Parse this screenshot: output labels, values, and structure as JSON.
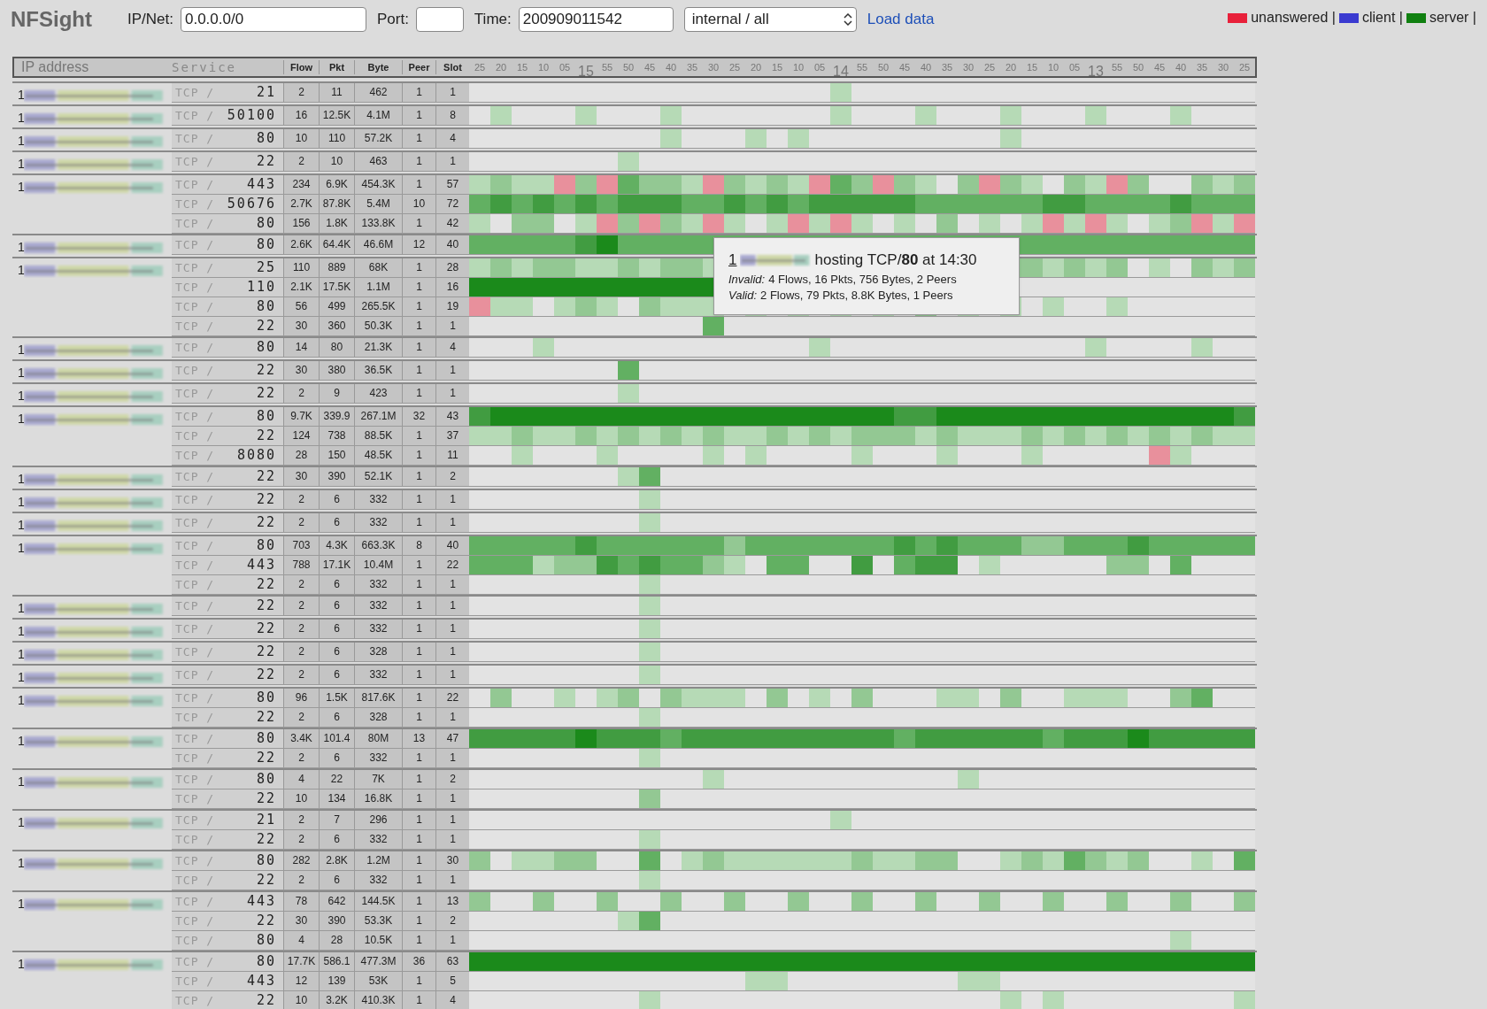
{
  "app": {
    "title": "NFSight"
  },
  "filters": {
    "ipnet_label": "IP/Net:",
    "ipnet_value": "0.0.0.0/0",
    "port_label": "Port:",
    "time_label": "Time:",
    "time_value": "200909011542",
    "scope": "internal / all",
    "load": "Load data"
  },
  "legend": [
    {
      "label": "unanswered |",
      "color": "#e8203a"
    },
    {
      "label": "client |",
      "color": "#3a3ad0"
    },
    {
      "label": "server |",
      "color": "#108010"
    }
  ],
  "table": {
    "columns": [
      "IP address",
      "Service",
      "Flow",
      "Pkt",
      "Byte",
      "Peer",
      "Slot"
    ],
    "timeline": [
      {
        "label": "25",
        "kind": "minute"
      },
      {
        "label": "20",
        "kind": "minute"
      },
      {
        "label": "15",
        "kind": "minute"
      },
      {
        "label": "10",
        "kind": "minute"
      },
      {
        "label": "05",
        "kind": "minute"
      },
      {
        "label": "15",
        "kind": "hour"
      },
      {
        "label": "55",
        "kind": "minute"
      },
      {
        "label": "50",
        "kind": "minute"
      },
      {
        "label": "45",
        "kind": "minute"
      },
      {
        "label": "40",
        "kind": "minute"
      },
      {
        "label": "35",
        "kind": "minute"
      },
      {
        "label": "30",
        "kind": "minute"
      },
      {
        "label": "25",
        "kind": "minute"
      },
      {
        "label": "20",
        "kind": "minute"
      },
      {
        "label": "15",
        "kind": "minute"
      },
      {
        "label": "10",
        "kind": "minute"
      },
      {
        "label": "05",
        "kind": "minute"
      },
      {
        "label": "14",
        "kind": "hour"
      },
      {
        "label": "55",
        "kind": "minute"
      },
      {
        "label": "50",
        "kind": "minute"
      },
      {
        "label": "45",
        "kind": "minute"
      },
      {
        "label": "40",
        "kind": "minute"
      },
      {
        "label": "35",
        "kind": "minute"
      },
      {
        "label": "30",
        "kind": "minute"
      },
      {
        "label": "25",
        "kind": "minute"
      },
      {
        "label": "20",
        "kind": "minute"
      },
      {
        "label": "15",
        "kind": "minute"
      },
      {
        "label": "10",
        "kind": "minute"
      },
      {
        "label": "05",
        "kind": "minute"
      },
      {
        "label": "13",
        "kind": "hour"
      },
      {
        "label": "55",
        "kind": "minute"
      },
      {
        "label": "50",
        "kind": "minute"
      },
      {
        "label": "45",
        "kind": "minute"
      },
      {
        "label": "40",
        "kind": "minute"
      },
      {
        "label": "35",
        "kind": "minute"
      },
      {
        "label": "30",
        "kind": "minute"
      },
      {
        "label": "25",
        "kind": "minute"
      }
    ],
    "hosts": [
      {
        "ip": "1",
        "services": [
          {
            "protocol": "TCP /",
            "port": "21",
            "flow": "2",
            "pkt": "11",
            "byte": "462",
            "peer": "1",
            "slot": "1"
          }
        ]
      },
      {
        "ip": "1",
        "services": [
          {
            "protocol": "TCP /",
            "port": "50100",
            "flow": "16",
            "pkt": "12.5K",
            "byte": "4.1M",
            "peer": "1",
            "slot": "8"
          }
        ]
      },
      {
        "ip": "1",
        "services": [
          {
            "protocol": "TCP /",
            "port": "80",
            "flow": "10",
            "pkt": "110",
            "byte": "57.2K",
            "peer": "1",
            "slot": "4"
          }
        ]
      },
      {
        "ip": "1",
        "services": [
          {
            "protocol": "TCP /",
            "port": "22",
            "flow": "2",
            "pkt": "10",
            "byte": "463",
            "peer": "1",
            "slot": "1"
          }
        ]
      },
      {
        "ip": "1",
        "services": [
          {
            "protocol": "TCP /",
            "port": "443",
            "flow": "234",
            "pkt": "6.9K",
            "byte": "454.3K",
            "peer": "1",
            "slot": "57"
          },
          {
            "protocol": "TCP /",
            "port": "50676",
            "flow": "2.7K",
            "pkt": "87.8K",
            "byte": "5.4M",
            "peer": "10",
            "slot": "72"
          },
          {
            "protocol": "TCP /",
            "port": "80",
            "flow": "156",
            "pkt": "1.8K",
            "byte": "133.8K",
            "peer": "1",
            "slot": "42"
          }
        ]
      },
      {
        "ip": "1",
        "services": [
          {
            "protocol": "TCP /",
            "port": "80",
            "flow": "2.6K",
            "pkt": "64.4K",
            "byte": "46.6M",
            "peer": "12",
            "slot": "40"
          }
        ]
      },
      {
        "ip": "1",
        "services": [
          {
            "protocol": "TCP /",
            "port": "25",
            "flow": "110",
            "pkt": "889",
            "byte": "68K",
            "peer": "1",
            "slot": "28"
          },
          {
            "protocol": "TCP /",
            "port": "110",
            "flow": "2.1K",
            "pkt": "17.5K",
            "byte": "1.1M",
            "peer": "1",
            "slot": "16"
          },
          {
            "protocol": "TCP /",
            "port": "80",
            "flow": "56",
            "pkt": "499",
            "byte": "265.5K",
            "peer": "1",
            "slot": "19"
          },
          {
            "protocol": "TCP /",
            "port": "22",
            "flow": "30",
            "pkt": "360",
            "byte": "50.3K",
            "peer": "1",
            "slot": "1"
          }
        ]
      },
      {
        "ip": "1",
        "services": [
          {
            "protocol": "TCP /",
            "port": "80",
            "flow": "14",
            "pkt": "80",
            "byte": "21.3K",
            "peer": "1",
            "slot": "4"
          }
        ]
      },
      {
        "ip": "1",
        "services": [
          {
            "protocol": "TCP /",
            "port": "22",
            "flow": "30",
            "pkt": "380",
            "byte": "36.5K",
            "peer": "1",
            "slot": "1"
          }
        ]
      },
      {
        "ip": "1",
        "services": [
          {
            "protocol": "TCP /",
            "port": "22",
            "flow": "2",
            "pkt": "9",
            "byte": "423",
            "peer": "1",
            "slot": "1"
          }
        ]
      },
      {
        "ip": "1",
        "services": [
          {
            "protocol": "TCP /",
            "port": "80",
            "flow": "9.7K",
            "pkt": "339.9",
            "byte": "267.1M",
            "peer": "32",
            "slot": "43"
          },
          {
            "protocol": "TCP /",
            "port": "22",
            "flow": "124",
            "pkt": "738",
            "byte": "88.5K",
            "peer": "1",
            "slot": "37"
          },
          {
            "protocol": "TCP /",
            "port": "8080",
            "flow": "28",
            "pkt": "150",
            "byte": "48.5K",
            "peer": "1",
            "slot": "11"
          }
        ]
      },
      {
        "ip": "1",
        "services": [
          {
            "protocol": "TCP /",
            "port": "22",
            "flow": "30",
            "pkt": "390",
            "byte": "52.1K",
            "peer": "1",
            "slot": "2"
          }
        ]
      },
      {
        "ip": "1",
        "services": [
          {
            "protocol": "TCP /",
            "port": "22",
            "flow": "2",
            "pkt": "6",
            "byte": "332",
            "peer": "1",
            "slot": "1"
          }
        ]
      },
      {
        "ip": "1",
        "services": [
          {
            "protocol": "TCP /",
            "port": "22",
            "flow": "2",
            "pkt": "6",
            "byte": "332",
            "peer": "1",
            "slot": "1"
          }
        ]
      },
      {
        "ip": "1",
        "services": [
          {
            "protocol": "TCP /",
            "port": "80",
            "flow": "703",
            "pkt": "4.3K",
            "byte": "663.3K",
            "peer": "8",
            "slot": "40"
          },
          {
            "protocol": "TCP /",
            "port": "443",
            "flow": "788",
            "pkt": "17.1K",
            "byte": "10.4M",
            "peer": "1",
            "slot": "22"
          },
          {
            "protocol": "TCP /",
            "port": "22",
            "flow": "2",
            "pkt": "6",
            "byte": "332",
            "peer": "1",
            "slot": "1"
          }
        ]
      },
      {
        "ip": "1",
        "services": [
          {
            "protocol": "TCP /",
            "port": "22",
            "flow": "2",
            "pkt": "6",
            "byte": "332",
            "peer": "1",
            "slot": "1"
          }
        ]
      },
      {
        "ip": "1",
        "services": [
          {
            "protocol": "TCP /",
            "port": "22",
            "flow": "2",
            "pkt": "6",
            "byte": "332",
            "peer": "1",
            "slot": "1"
          }
        ]
      },
      {
        "ip": "1",
        "services": [
          {
            "protocol": "TCP /",
            "port": "22",
            "flow": "2",
            "pkt": "6",
            "byte": "328",
            "peer": "1",
            "slot": "1"
          }
        ]
      },
      {
        "ip": "1",
        "services": [
          {
            "protocol": "TCP /",
            "port": "22",
            "flow": "2",
            "pkt": "6",
            "byte": "332",
            "peer": "1",
            "slot": "1"
          }
        ]
      },
      {
        "ip": "1",
        "services": [
          {
            "protocol": "TCP /",
            "port": "80",
            "flow": "96",
            "pkt": "1.5K",
            "byte": "817.6K",
            "peer": "1",
            "slot": "22"
          },
          {
            "protocol": "TCP /",
            "port": "22",
            "flow": "2",
            "pkt": "6",
            "byte": "328",
            "peer": "1",
            "slot": "1"
          }
        ]
      },
      {
        "ip": "1",
        "services": [
          {
            "protocol": "TCP /",
            "port": "80",
            "flow": "3.4K",
            "pkt": "101.4",
            "byte": "80M",
            "peer": "13",
            "slot": "47"
          },
          {
            "protocol": "TCP /",
            "port": "22",
            "flow": "2",
            "pkt": "6",
            "byte": "332",
            "peer": "1",
            "slot": "1"
          }
        ]
      },
      {
        "ip": "1",
        "services": [
          {
            "protocol": "TCP /",
            "port": "80",
            "flow": "4",
            "pkt": "22",
            "byte": "7K",
            "peer": "1",
            "slot": "2"
          },
          {
            "protocol": "TCP /",
            "port": "22",
            "flow": "10",
            "pkt": "134",
            "byte": "16.8K",
            "peer": "1",
            "slot": "1"
          }
        ]
      },
      {
        "ip": "1",
        "services": [
          {
            "protocol": "TCP /",
            "port": "21",
            "flow": "2",
            "pkt": "7",
            "byte": "296",
            "peer": "1",
            "slot": "1"
          },
          {
            "protocol": "TCP /",
            "port": "22",
            "flow": "2",
            "pkt": "6",
            "byte": "332",
            "peer": "1",
            "slot": "1"
          }
        ]
      },
      {
        "ip": "1",
        "services": [
          {
            "protocol": "TCP /",
            "port": "80",
            "flow": "282",
            "pkt": "2.8K",
            "byte": "1.2M",
            "peer": "1",
            "slot": "30"
          },
          {
            "protocol": "TCP /",
            "port": "22",
            "flow": "2",
            "pkt": "6",
            "byte": "332",
            "peer": "1",
            "slot": "1"
          }
        ]
      },
      {
        "ip": "1",
        "services": [
          {
            "protocol": "TCP /",
            "port": "443",
            "flow": "78",
            "pkt": "642",
            "byte": "144.5K",
            "peer": "1",
            "slot": "13"
          },
          {
            "protocol": "TCP /",
            "port": "22",
            "flow": "30",
            "pkt": "390",
            "byte": "53.3K",
            "peer": "1",
            "slot": "2"
          },
          {
            "protocol": "TCP /",
            "port": "80",
            "flow": "4",
            "pkt": "28",
            "byte": "10.5K",
            "peer": "1",
            "slot": "1"
          }
        ]
      },
      {
        "ip": "1",
        "services": [
          {
            "protocol": "TCP /",
            "port": "80",
            "flow": "17.7K",
            "pkt": "586.1",
            "byte": "477.3M",
            "peer": "36",
            "slot": "63"
          },
          {
            "protocol": "TCP /",
            "port": "443",
            "flow": "12",
            "pkt": "139",
            "byte": "53K",
            "peer": "1",
            "slot": "5"
          },
          {
            "protocol": "TCP /",
            "port": "22",
            "flow": "10",
            "pkt": "3.2K",
            "byte": "410.3K",
            "peer": "1",
            "slot": "4"
          }
        ]
      }
    ]
  },
  "tooltip": {
    "ip": "1",
    "text": "hosting TCP/**80** at 14:30",
    "lines": [
      {
        "label": "Invalid:",
        "text": "4 Flows, 16 Pkts, 756 Bytes, 2 Peers"
      },
      {
        "label": "Valid:",
        "text": "2 Flows, 79 Pkts, 8.8K Bytes, 1 Peers"
      }
    ]
  }
}
